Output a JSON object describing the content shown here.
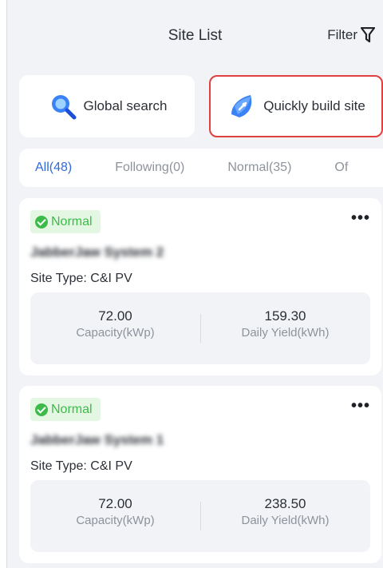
{
  "header": {
    "title": "Site List",
    "filter_label": "Filter"
  },
  "actions": {
    "global_search": "Global search",
    "quick_build": "Quickly build site"
  },
  "tabs": [
    {
      "label": "All(48)",
      "active": true
    },
    {
      "label": "Following(0)",
      "active": false
    },
    {
      "label": "Normal(35)",
      "active": false
    },
    {
      "label": "Of",
      "active": false
    }
  ],
  "sites": [
    {
      "status": "Normal",
      "name": "JabberJaw System 2",
      "site_type": "Site Type: C&I PV",
      "capacity_value": "72.00",
      "capacity_label": "Capacity(kWp)",
      "yield_value": "159.30",
      "yield_label": "Daily Yield(kWh)"
    },
    {
      "status": "Normal",
      "name": "JabberJaw System 1",
      "site_type": "Site Type: C&I PV",
      "capacity_value": "72.00",
      "capacity_label": "Capacity(kWp)",
      "yield_value": "238.50",
      "yield_label": "Daily Yield(kWh)"
    }
  ],
  "colors": {
    "accent": "#2f6bdc",
    "status_green": "#3dbb4a",
    "highlight_red": "#e0403f"
  }
}
